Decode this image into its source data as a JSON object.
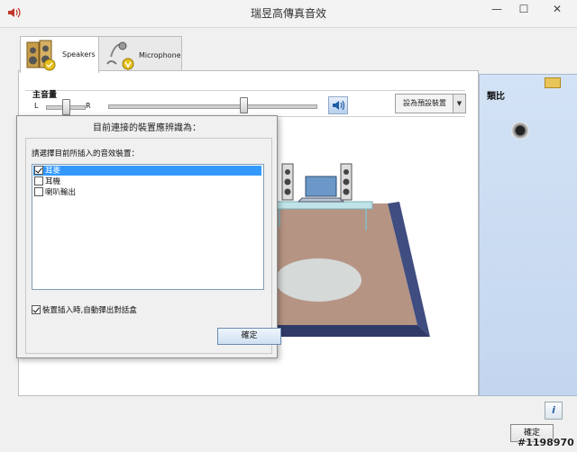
{
  "window": {
    "title": "瑞昱高傳真音效",
    "minimize": "—",
    "maximize": "☐",
    "close": "✕"
  },
  "tabs": [
    {
      "label": "Speakers",
      "icon": "speaker-icon",
      "active": true
    },
    {
      "label": "Microphone",
      "icon": "microphone-icon",
      "active": false
    }
  ],
  "volume": {
    "label": "主音量",
    "left": "L",
    "right": "R",
    "balance_level": 0.5,
    "master_level": 0.65
  },
  "default_device": {
    "label": "設為預設裝置",
    "dropdown": "▼"
  },
  "right_panel": {
    "label": "類比"
  },
  "dialog": {
    "title": "目前連接的裝置應辨識為：",
    "prompt": "請選擇目前所插入的音效裝置：",
    "devices": [
      {
        "label": "耳麥",
        "checked": true,
        "selected": true
      },
      {
        "label": "耳機",
        "checked": false,
        "selected": false
      },
      {
        "label": "喇叭輸出",
        "checked": false,
        "selected": false
      }
    ],
    "auto_popup": {
      "label": "裝置插入時,自動彈出對話盒",
      "checked": true
    },
    "ok": "確定"
  },
  "footer": {
    "ok": "確定",
    "info": "i",
    "watermark": "#1198970"
  },
  "colors": {
    "selection": "#3399ff",
    "right_panel": "#c9daf1",
    "floor": "#b69484"
  }
}
